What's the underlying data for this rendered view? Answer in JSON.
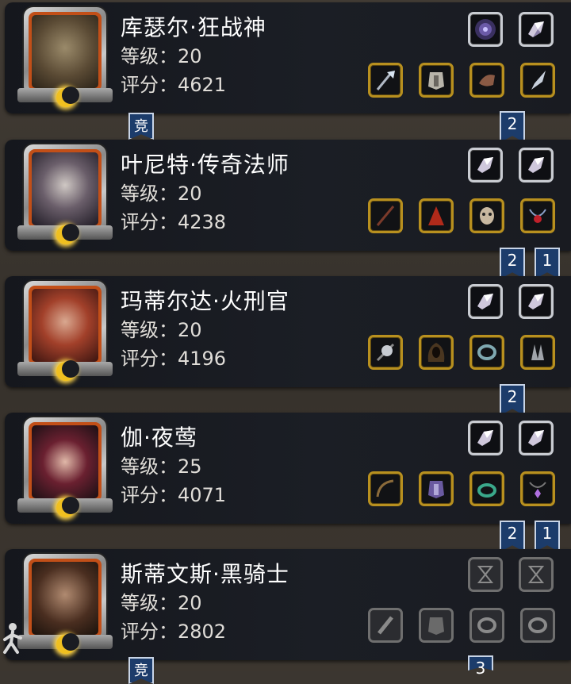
{
  "colors": {
    "flag": "#1c3c6b",
    "gear_border": "#b8901f",
    "gem_border": "#c9ccd2",
    "portrait_frame": "#c24f18"
  },
  "heroes": [
    {
      "name": "库瑟尔·狂战神",
      "level_label": "等级：20",
      "score_label": "评分：4621",
      "gems": [
        "dark-orb-icon",
        "crystal-icon"
      ],
      "gear": [
        "axe-icon",
        "armor-icon",
        "gauntlet-icon",
        "blade-icon"
      ],
      "flags_below": [
        "2"
      ],
      "arena_top": "",
      "arena_bottom": "竞"
    },
    {
      "name": "叶尼特·传奇法师",
      "level_label": "等级：20",
      "score_label": "评分：4238",
      "gems": [
        "crystal-icon",
        "crystal-icon"
      ],
      "gear": [
        "staff-icon",
        "cloak-icon",
        "mask-icon",
        "orb-necklace-icon"
      ],
      "flags_below": [
        "2",
        "1"
      ]
    },
    {
      "name": "玛蒂尔达·火刑官",
      "level_label": "等级：20",
      "score_label": "评分：4196",
      "gems": [
        "crystal-icon",
        "crystal-icon"
      ],
      "gear": [
        "double-axe-icon",
        "hood-icon",
        "ring-icon",
        "claw-icon"
      ],
      "flags_below": [
        "2"
      ]
    },
    {
      "name": "伽·夜莺",
      "level_label": "等级：25",
      "score_label": "评分：4071",
      "gems": [
        "crystal-icon",
        "crystal-icon"
      ],
      "gear": [
        "bow-icon",
        "armor-icon",
        "ring-icon",
        "amulet-icon"
      ],
      "flags_below": [
        "2",
        "1"
      ]
    },
    {
      "name": "斯蒂文斯·黑骑士",
      "level_label": "等级：20",
      "score_label": "评分：2802",
      "gems": [
        "hourglass-slot-icon",
        "hourglass-slot-icon"
      ],
      "gear": [
        "sword-slot-icon",
        "armor-slot-icon",
        "ring-slot-icon",
        "ring-slot-icon"
      ],
      "flags_below": [
        "3"
      ],
      "arena_bottom": "竞"
    }
  ],
  "arena_label": "竞"
}
